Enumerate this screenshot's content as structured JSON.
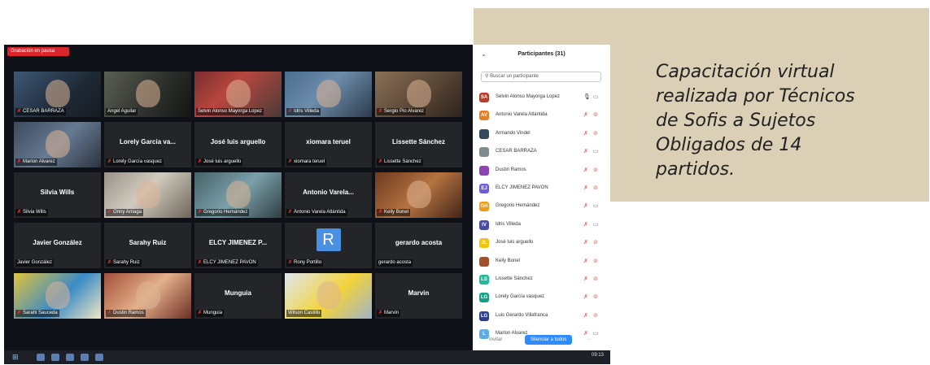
{
  "caption": {
    "lines": [
      "Capacitación virtual",
      "realizada por Técnicos",
      "de Sofis a Sujetos",
      "Obligados de 14",
      "partidos."
    ]
  },
  "recording_badge": "Grabación en pausa",
  "tiles": [
    {
      "label": "CESAR BARRAZA",
      "muted": true,
      "video": true
    },
    {
      "label": "Angel Aguilar",
      "muted": false,
      "video": true
    },
    {
      "label": "Selvin Alonso Mayorga Lopez",
      "muted": false,
      "video": true,
      "active": true
    },
    {
      "label": "Idris Villeda",
      "muted": true,
      "video": true
    },
    {
      "label": "Sergio Pio Alvarez",
      "muted": true,
      "video": true
    },
    {
      "label": "Marlon Alvarez",
      "muted": true,
      "video": true
    },
    {
      "center": "Lorely Garcia va...",
      "label": "Lorely García vasquez",
      "muted": true
    },
    {
      "center": "José luis arguello",
      "label": "José luis arguello",
      "muted": true
    },
    {
      "center": "xiomara teruel",
      "label": "xiomara teruel",
      "muted": true
    },
    {
      "center": "Lissette Sánchez",
      "label": "Lissette Sánchez",
      "muted": true
    },
    {
      "center": "Silvia Wills",
      "label": "Silvia Wills",
      "muted": true
    },
    {
      "label": "Onny Arriaga",
      "muted": true,
      "video": true
    },
    {
      "label": "Gregorio Hernández",
      "muted": true,
      "video": true
    },
    {
      "center": "Antonio Varela...",
      "label": "Antonio Varela Atlántida",
      "muted": true
    },
    {
      "label": "Kelly Bonel",
      "muted": true,
      "video": true
    },
    {
      "center": "Javier González",
      "label": "Javier González",
      "muted": false
    },
    {
      "center": "Sarahy Ruiz",
      "label": "Sarahy Ruiz",
      "muted": true
    },
    {
      "center": "ELCY JIMENEZ P...",
      "label": "ELCY JIMENEZ PAVON",
      "muted": true
    },
    {
      "avatar": "R",
      "label": "Rony Portillo",
      "muted": true
    },
    {
      "center": "gerardo acosta",
      "label": "gerardo acosta",
      "muted": false
    },
    {
      "label": "Sarahi Sauceda",
      "muted": true,
      "video": true
    },
    {
      "label": "Dustin Ramos",
      "muted": true,
      "video": true
    },
    {
      "center": "Munguia",
      "label": "Munguia",
      "muted": true
    },
    {
      "label": "Wilson Castillo",
      "muted": false,
      "video": true
    },
    {
      "center": "Marvin",
      "label": "Marvin",
      "muted": true
    }
  ],
  "participants_panel": {
    "title": "Participantes (31)",
    "search_placeholder": "Buscar un participante",
    "participants": [
      {
        "initials": "SA",
        "name": "Selvin Alonso Mayorga Lopez",
        "color": "#c0392b"
      },
      {
        "initials": "AV",
        "name": "Antonio Varela Atlántida",
        "color": "#e67e22"
      },
      {
        "initials": "",
        "name": "Armando Vindel",
        "color": "#34495e"
      },
      {
        "initials": "",
        "name": "CESAR BARRAZA",
        "color": "#7f8c8d"
      },
      {
        "initials": "",
        "name": "Dustin Ramos",
        "color": "#8e44ad"
      },
      {
        "initials": "EJ",
        "name": "ELCY JIMENEZ PAVON",
        "color": "#6c5ce7"
      },
      {
        "initials": "GH",
        "name": "Gregorio Hernández",
        "color": "#f39c12"
      },
      {
        "initials": "IV",
        "name": "Idris Villeda",
        "color": "#4a4aa8"
      },
      {
        "initials": "JL",
        "name": "José luis arguello",
        "color": "#f1c40f"
      },
      {
        "initials": "",
        "name": "Kelly Bonel",
        "color": "#a0522d"
      },
      {
        "initials": "LS",
        "name": "Lissette Sánchez",
        "color": "#1abc9c"
      },
      {
        "initials": "LG",
        "name": "Lorely García vasquez",
        "color": "#16a085"
      },
      {
        "initials": "LG",
        "name": "Luis Gerardo Villafranca",
        "color": "#2c3e90"
      },
      {
        "initials": "L",
        "name": "Marlon Alvarez",
        "color": "#5dade2"
      }
    ],
    "invite_label": "Invitar",
    "mute_all_label": "Silenciar a todos"
  },
  "taskbar": {
    "time": "09:13"
  }
}
